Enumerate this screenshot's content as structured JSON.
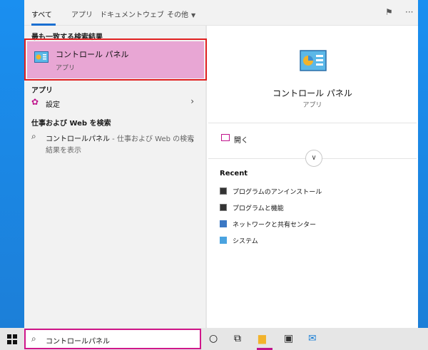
{
  "tabs": [
    {
      "label": "すべて"
    },
    {
      "label": "アプリ"
    },
    {
      "label": "ドキュメント"
    },
    {
      "label": "ウェブ"
    },
    {
      "label": "その他"
    }
  ],
  "sections": {
    "best_match": "最も一致する検索結果",
    "apps": "アプリ",
    "web": "仕事および Web を検索"
  },
  "best_match": {
    "title": "コントロール パネル",
    "subtitle": "アプリ"
  },
  "apps": [
    {
      "label": "設定"
    }
  ],
  "web_result": {
    "query": "コントロールパネル",
    "suffix": " - 仕事および Web の検索",
    "line2": "結果を表示"
  },
  "detail": {
    "title": "コントロール パネル",
    "subtitle": "アプリ",
    "open_label": "開く",
    "recent_heading": "Recent",
    "recent_items": [
      {
        "label": "プログラムのアンインストール"
      },
      {
        "label": "プログラムと機能"
      },
      {
        "label": "ネットワークと共有センター"
      },
      {
        "label": "システム"
      }
    ]
  },
  "taskbar": {
    "search_value": "コントロールパネル"
  },
  "colors": {
    "accent": "#c0148c",
    "selection": "#e8a6d4",
    "highlight_box": "#e02020",
    "tab_underline": "#1a6fd1"
  }
}
